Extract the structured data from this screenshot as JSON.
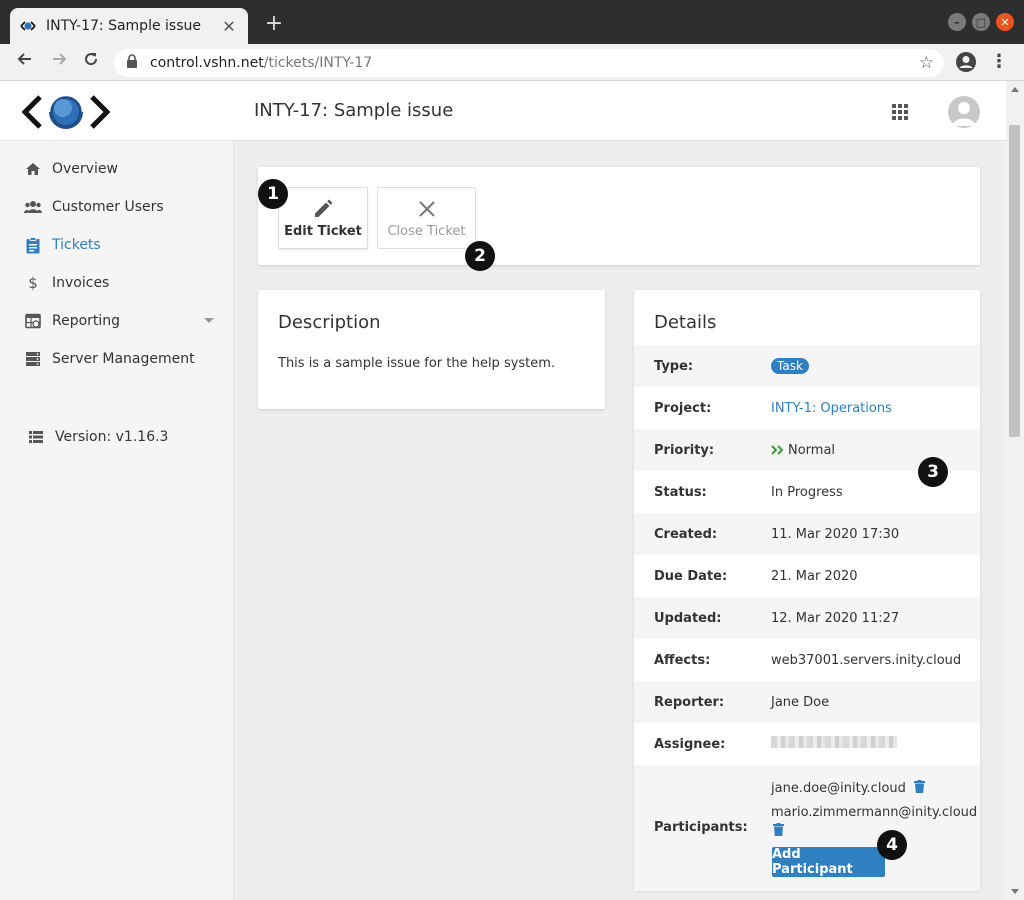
{
  "browser": {
    "tab_title": "INTY-17: Sample issue",
    "tab_close": "✕",
    "new_tab": "+",
    "url_host": "control.vshn.net",
    "url_path": "/tickets/INTY-17",
    "window_buttons": [
      "–",
      "□",
      "✕"
    ]
  },
  "header": {
    "title": "INTY-17: Sample issue"
  },
  "sidebar": {
    "items": [
      {
        "label": "Overview",
        "icon": "home-icon"
      },
      {
        "label": "Customer Users",
        "icon": "users-icon"
      },
      {
        "label": "Tickets",
        "icon": "clipboard-icon",
        "active": true
      },
      {
        "label": "Invoices",
        "icon": "dollar-icon"
      },
      {
        "label": "Reporting",
        "icon": "calendar-table-icon"
      },
      {
        "label": "Server Management",
        "icon": "server-icon"
      }
    ],
    "version": "Version: v1.16.3"
  },
  "actions": {
    "edit_label": "Edit Ticket",
    "close_label": "Close Ticket"
  },
  "markers": [
    "1",
    "2",
    "3",
    "4"
  ],
  "description": {
    "title": "Description",
    "text": "This is a sample issue for the help system."
  },
  "details": {
    "title": "Details",
    "rows": [
      {
        "label": "Type:",
        "value": "Task"
      },
      {
        "label": "Project:",
        "value": "INTY-1: Operations"
      },
      {
        "label": "Priority:",
        "value": "Normal"
      },
      {
        "label": "Status:",
        "value": "In Progress"
      },
      {
        "label": "Created:",
        "value": "11. Mar 2020 17:30"
      },
      {
        "label": "Due Date:",
        "value": "21. Mar 2020"
      },
      {
        "label": "Updated:",
        "value": "12. Mar 2020 11:27"
      },
      {
        "label": "Affects:",
        "value": "web37001.servers.inity.cloud"
      },
      {
        "label": "Reporter:",
        "value": "Jane Doe"
      },
      {
        "label": "Assignee:",
        "value": ""
      }
    ],
    "participants_label": "Participants:",
    "participants": [
      "jane.doe@inity.cloud",
      "mario.zimmermann@inity.cloud"
    ],
    "add_participant_label": "Add Participant"
  },
  "colors": {
    "accent": "#2f7fc1",
    "priority_normal": "#3c9a3c"
  }
}
